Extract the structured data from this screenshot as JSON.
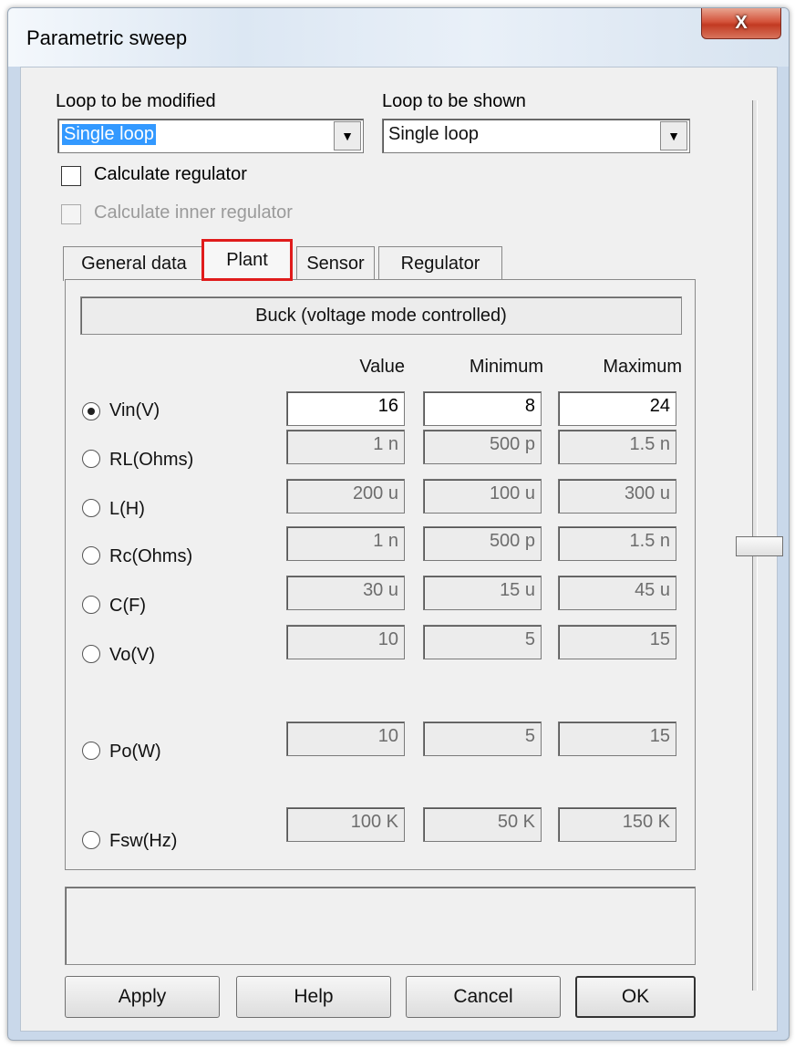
{
  "window": {
    "title": "Parametric sweep",
    "close_label": "X"
  },
  "loop_modified": {
    "label": "Loop to be modified",
    "value": "Single loop"
  },
  "loop_shown": {
    "label": "Loop to be shown",
    "value": "Single loop"
  },
  "calc_regulator": {
    "label": "Calculate regulator",
    "checked": false
  },
  "calc_inner_regulator": {
    "label": "Calculate inner regulator",
    "checked": false,
    "enabled": false
  },
  "tabs": [
    {
      "label": "General data",
      "active": false
    },
    {
      "label": "Plant",
      "active": true
    },
    {
      "label": "Sensor",
      "active": false
    },
    {
      "label": "Regulator",
      "active": false
    }
  ],
  "plant": {
    "header": "Buck (voltage mode controlled)",
    "columns": [
      "Value",
      "Minimum",
      "Maximum"
    ],
    "rows": [
      {
        "label": "Vin(V)",
        "selected": true,
        "value": "16",
        "min": "8",
        "max": "24"
      },
      {
        "label": "RL(Ohms)",
        "selected": false,
        "value": "1 n",
        "min": "500 p",
        "max": "1.5 n"
      },
      {
        "label": "L(H)",
        "selected": false,
        "value": "200 u",
        "min": "100 u",
        "max": "300 u"
      },
      {
        "label": "Rc(Ohms)",
        "selected": false,
        "value": "1 n",
        "min": "500 p",
        "max": "1.5 n"
      },
      {
        "label": "C(F)",
        "selected": false,
        "value": "30 u",
        "min": "15 u",
        "max": "45 u"
      },
      {
        "label": "Vo(V)",
        "selected": false,
        "value": "10",
        "min": "5",
        "max": "15"
      },
      {
        "label": "Po(W)",
        "selected": false,
        "value": "10",
        "min": "5",
        "max": "15"
      },
      {
        "label": "Fsw(Hz)",
        "selected": false,
        "value": "100 K",
        "min": "50 K",
        "max": "150 K"
      }
    ]
  },
  "buttons": {
    "apply": "Apply",
    "help": "Help",
    "cancel": "Cancel",
    "ok": "OK"
  },
  "icons": {
    "dropdown": "chevron-down-icon",
    "close": "close-icon"
  }
}
